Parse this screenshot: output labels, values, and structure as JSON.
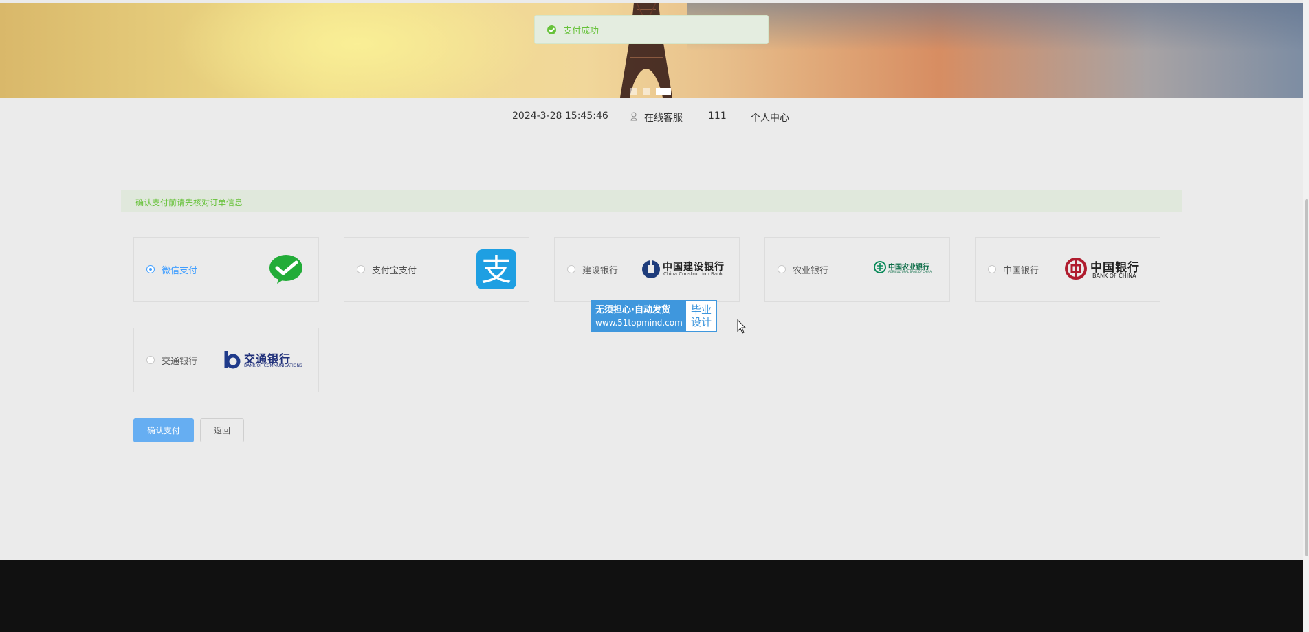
{
  "toast": {
    "text": "支付成功",
    "icon": "check-circle-icon",
    "color": "#67c23a"
  },
  "topbar": {
    "datetime": "2024-3-28 15:45:46",
    "service_label": "在线客服",
    "username": "111",
    "profile_label": "个人中心"
  },
  "banner": {
    "slides": 3,
    "active_slide": 3
  },
  "notice": "确认支付前请先核对订单信息",
  "payment_methods": [
    {
      "label": "微信支付",
      "selected": true,
      "logo": "wechat-pay-logo"
    },
    {
      "label": "支付宝支付",
      "selected": false,
      "logo": "alipay-logo"
    },
    {
      "label": "建设银行",
      "selected": false,
      "logo": "ccb-logo",
      "logo_text": "中国建设银行",
      "logo_sub": "China Construction Bank"
    },
    {
      "label": "农业银行",
      "selected": false,
      "logo": "abc-logo",
      "logo_text": "中国农业银行",
      "logo_sub": "AGRICULTURAL BANK OF CHINA"
    },
    {
      "label": "中国银行",
      "selected": false,
      "logo": "boc-logo",
      "logo_text": "中国银行",
      "logo_sub": "BANK OF CHINA"
    },
    {
      "label": "交通银行",
      "selected": false,
      "logo": "bocom-logo",
      "logo_text": "交通银行",
      "logo_sub": "BANK OF COMMUNICATIONS"
    }
  ],
  "buttons": {
    "confirm": "确认支付",
    "back": "返回"
  },
  "watermark": {
    "line1": "无须担心·自动发货",
    "url": "www.51topmind.com",
    "tag1": "毕业",
    "tag2": "设计"
  },
  "colors": {
    "accent": "#409eff",
    "confirm_button": "#66aef2",
    "success": "#67c23a",
    "footer": "#111111"
  }
}
